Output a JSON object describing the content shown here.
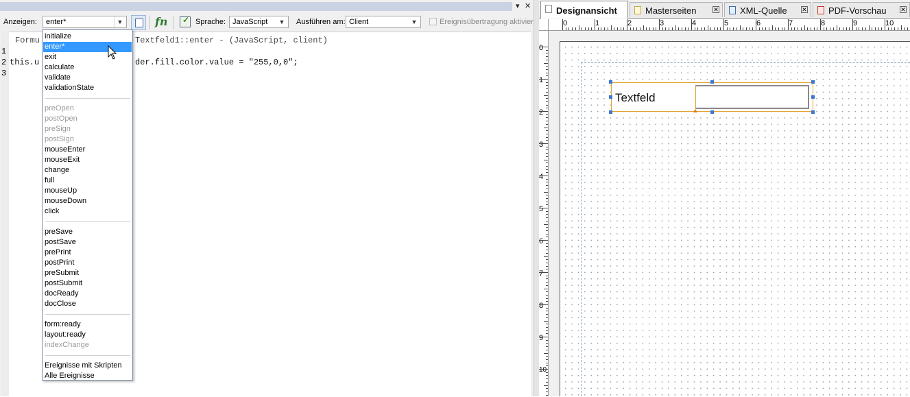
{
  "left_panel": {
    "title_controls": {
      "pin": "▾",
      "close": "✕"
    },
    "toolbar": {
      "show_label": "Anzeigen:",
      "show_value": "enter*",
      "language_label": "Sprache:",
      "language_value": "JavaScript",
      "run_at_label": "Ausführen am:",
      "run_at_value": "Client",
      "propagate_label": "Ereignisübertragung aktivier",
      "fn_label": "fn"
    },
    "editor": {
      "header_line_left": "Formu",
      "header_line_right": "Textfeld1::enter - (JavaScript, client)",
      "line_numbers": [
        "1",
        "2",
        "3"
      ],
      "code_left": "this.u",
      "code_right": "der.fill.color.value = \"255,0,0\";"
    }
  },
  "event_dropdown": {
    "groups": [
      [
        {
          "label": "initialize",
          "disabled": false
        },
        {
          "label": "enter*",
          "disabled": false,
          "selected": true
        },
        {
          "label": "exit",
          "disabled": false
        },
        {
          "label": "calculate",
          "disabled": false
        },
        {
          "label": "validate",
          "disabled": false
        },
        {
          "label": "validationState",
          "disabled": false
        }
      ],
      [
        {
          "label": "preOpen",
          "disabled": true
        },
        {
          "label": "postOpen",
          "disabled": true
        },
        {
          "label": "preSign",
          "disabled": true
        },
        {
          "label": "postSign",
          "disabled": true
        },
        {
          "label": "mouseEnter",
          "disabled": false
        },
        {
          "label": "mouseExit",
          "disabled": false
        },
        {
          "label": "change",
          "disabled": false
        },
        {
          "label": "full",
          "disabled": false
        },
        {
          "label": "mouseUp",
          "disabled": false
        },
        {
          "label": "mouseDown",
          "disabled": false
        },
        {
          "label": "click",
          "disabled": false
        }
      ],
      [
        {
          "label": "preSave",
          "disabled": false
        },
        {
          "label": "postSave",
          "disabled": false
        },
        {
          "label": "prePrint",
          "disabled": false
        },
        {
          "label": "postPrint",
          "disabled": false
        },
        {
          "label": "preSubmit",
          "disabled": false
        },
        {
          "label": "postSubmit",
          "disabled": false
        },
        {
          "label": "docReady",
          "disabled": false
        },
        {
          "label": "docClose",
          "disabled": false
        }
      ],
      [
        {
          "label": "form:ready",
          "disabled": false
        },
        {
          "label": "layout:ready",
          "disabled": false
        },
        {
          "label": "indexChange",
          "disabled": true
        }
      ],
      [
        {
          "label": "Ereignisse mit Skripten",
          "disabled": false
        },
        {
          "label": "Alle Ereignisse",
          "disabled": false
        }
      ]
    ]
  },
  "tabs": [
    {
      "label": "Designansicht",
      "active": true,
      "icon": "page-icon"
    },
    {
      "label": "Masterseiten",
      "active": false,
      "icon": "master-page-icon"
    },
    {
      "label": "XML-Quelle",
      "active": false,
      "icon": "xml-icon"
    },
    {
      "label": "PDF-Vorschau",
      "active": false,
      "icon": "pdf-icon"
    }
  ],
  "ruler": {
    "top": [
      "0",
      "1",
      "2",
      "3",
      "4",
      "5",
      "6",
      "7",
      "8",
      "9",
      "10"
    ],
    "left": [
      "0",
      "1",
      "2",
      "3",
      "4",
      "5",
      "6",
      "7",
      "8",
      "9",
      "10"
    ]
  },
  "design": {
    "field_caption": "Textfeld"
  },
  "colors": {
    "selection": "#3399ff",
    "field_border": "#e2a12a",
    "handles": "#3a78d4"
  }
}
